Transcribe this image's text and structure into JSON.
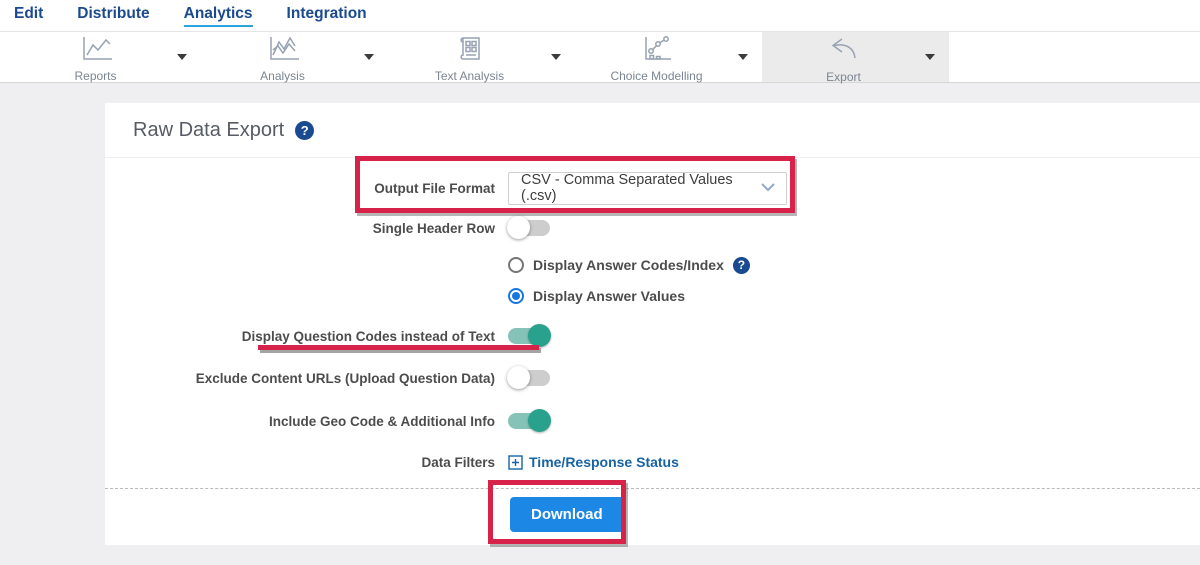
{
  "nav": {
    "items": [
      {
        "label": "Edit",
        "active": false
      },
      {
        "label": "Distribute",
        "active": false
      },
      {
        "label": "Analytics",
        "active": true
      },
      {
        "label": "Integration",
        "active": false
      }
    ]
  },
  "toolbar": {
    "items": [
      {
        "label": "Reports",
        "icon": "line-chart-icon",
        "active": false
      },
      {
        "label": "Analysis",
        "icon": "multi-line-chart-icon",
        "active": false
      },
      {
        "label": "Text Analysis",
        "icon": "newspaper-grid-icon",
        "active": false
      },
      {
        "label": "Choice Modelling",
        "icon": "scatter-chart-icon",
        "active": false
      },
      {
        "label": "Export",
        "icon": "export-arrow-icon",
        "active": true
      }
    ]
  },
  "page": {
    "title": "Raw Data Export"
  },
  "icons": {
    "help_glyph": "?"
  },
  "form": {
    "output_file_format": {
      "label": "Output File Format",
      "value": "CSV - Comma Separated Values (.csv)"
    },
    "single_header_row": {
      "label": "Single Header Row",
      "enabled": false
    },
    "answer_display": {
      "options": [
        {
          "label": "Display Answer Codes/Index",
          "selected": false,
          "has_help": true
        },
        {
          "label": "Display Answer Values",
          "selected": true,
          "has_help": false
        }
      ]
    },
    "question_codes": {
      "label": "Display Question Codes instead of Text",
      "enabled": true
    },
    "exclude_content_urls": {
      "label": "Exclude Content URLs (Upload Question Data)",
      "enabled": false
    },
    "include_geo": {
      "label": "Include Geo Code & Additional Info",
      "enabled": true
    },
    "data_filters": {
      "label": "Data Filters",
      "link_label": "Time/Response Status"
    }
  },
  "actions": {
    "download_label": "Download"
  },
  "colors": {
    "nav_blue": "#1b4a8f",
    "active_underline": "#2fa3df",
    "toggle_on_teal": "#28a18d",
    "radio_blue": "#1777e0",
    "download_blue": "#1c87e5",
    "link_blue": "#1763a6",
    "annotation_red": "#d7234a"
  }
}
